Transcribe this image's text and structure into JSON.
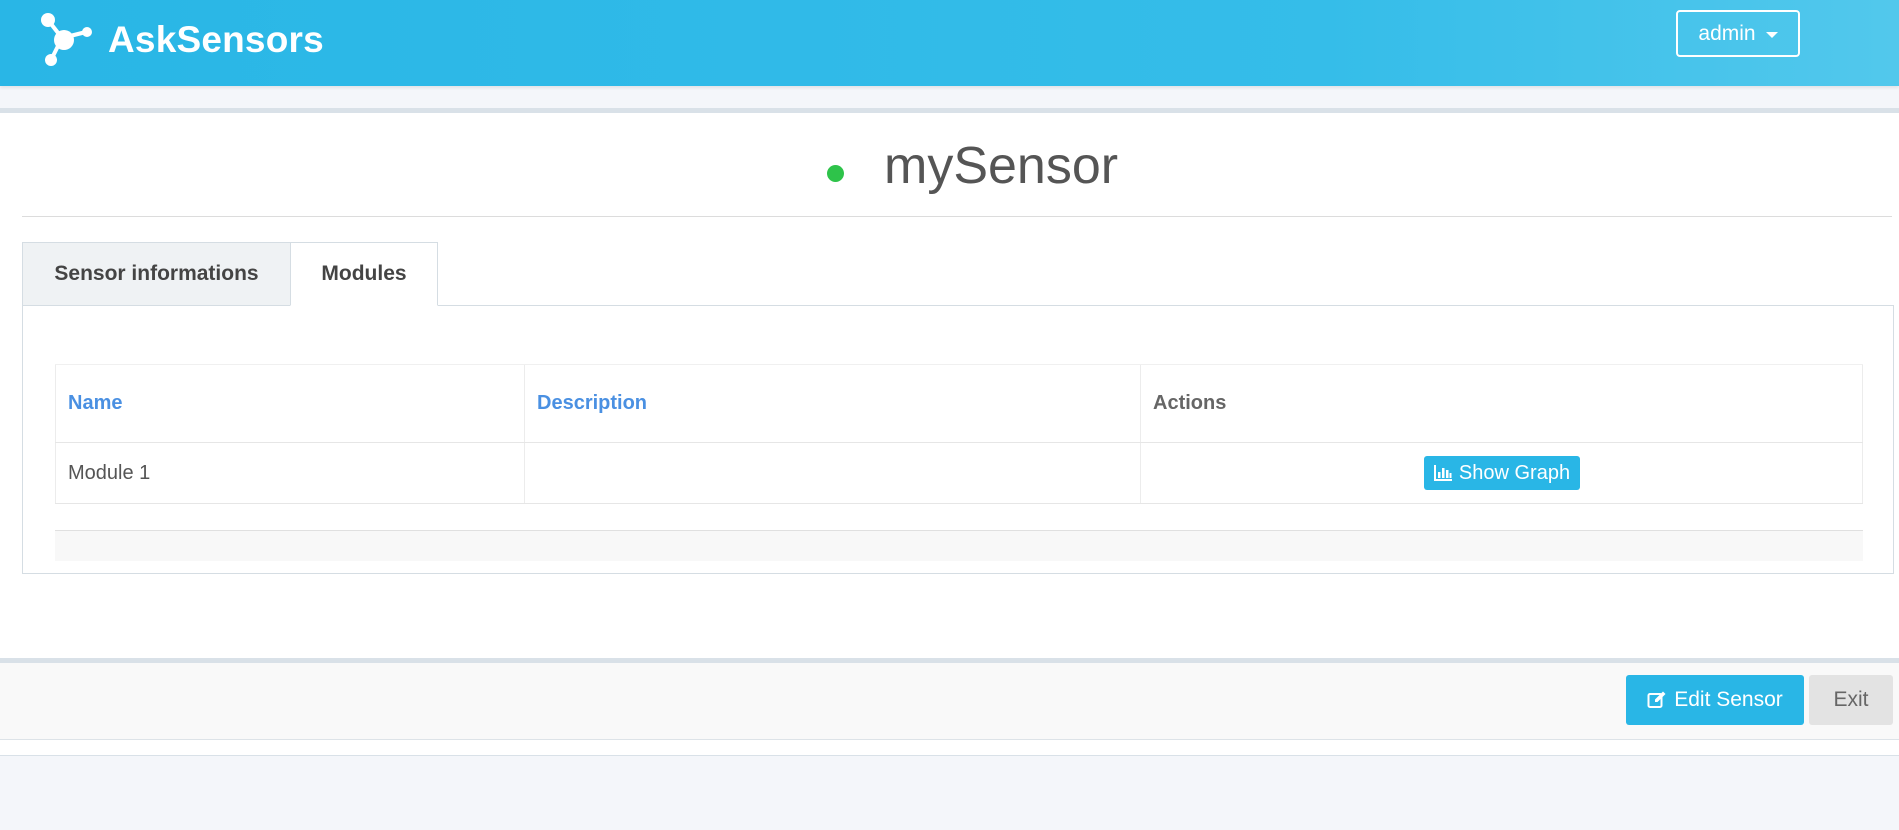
{
  "header": {
    "brand_name": "AskSensors",
    "user_menu_label": "admin"
  },
  "sensor": {
    "title": "mySensor",
    "status_color": "#2ec34a"
  },
  "tabs": [
    {
      "label": "Sensor informations",
      "active": false
    },
    {
      "label": "Modules",
      "active": true
    }
  ],
  "modules_table": {
    "columns": [
      "Name",
      "Description",
      "Actions"
    ],
    "rows": [
      {
        "name": "Module 1",
        "description": "",
        "action_label": "Show Graph"
      }
    ]
  },
  "footer": {
    "edit_label": "Edit Sensor",
    "exit_label": "Exit"
  },
  "icons": {
    "brand": "molecule-logo-icon",
    "graph": "bar-chart-icon",
    "edit": "edit-icon"
  },
  "colors": {
    "accent": "#29b6e6",
    "link": "#4a90e2"
  }
}
